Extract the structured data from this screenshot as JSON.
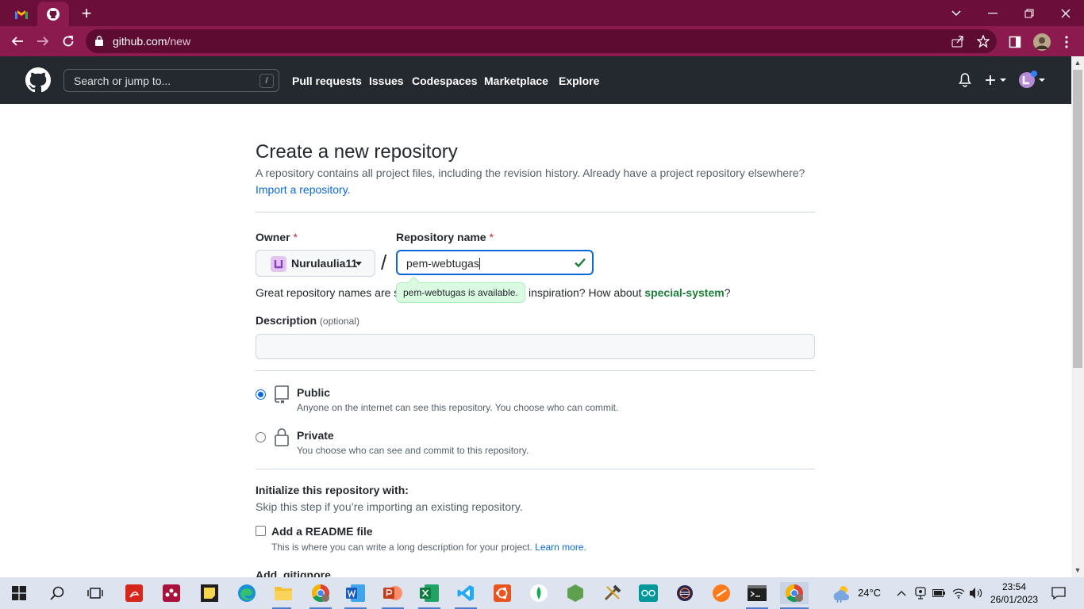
{
  "browser": {
    "url_host": "github.com",
    "url_path": "/new"
  },
  "github_header": {
    "search_placeholder": "Search or jump to...",
    "search_shortcut": "/",
    "nav": [
      "Pull requests",
      "Issues",
      "Codespaces",
      "Marketplace",
      "Explore"
    ]
  },
  "page": {
    "title": "Create a new repository",
    "subtitle": "A repository contains all project files, including the revision history. Already have a project repository elsewhere?",
    "import_link": "Import a repository.",
    "owner_label": "Owner",
    "required_mark": "*",
    "owner_name": "Nurulaulia11",
    "separator": "/",
    "repo_name_label": "Repository name",
    "repo_name_value": "pem-webtugas",
    "availability_tooltip": "pem-webtugas is available.",
    "great_prefix": "Great repository names are s",
    "great_middle": "d inspiration? How about ",
    "suggestion": "special-system",
    "great_suffix": "?",
    "description_label": "Description",
    "description_optional": "(optional)",
    "visibility": [
      {
        "title": "Public",
        "desc": "Anyone on the internet can see this repository. You choose who can commit.",
        "selected": true
      },
      {
        "title": "Private",
        "desc": "You choose who can see and commit to this repository.",
        "selected": false
      }
    ],
    "init_title": "Initialize this repository with:",
    "init_sub": "Skip this step if you’re importing an existing repository.",
    "readme_label": "Add a README file",
    "readme_desc": "This is where you can write a long description for your project. ",
    "readme_link": "Learn more.",
    "gitignore_label": "Add .gitignore"
  },
  "taskbar": {
    "weather": "24°C",
    "time": "23:54",
    "date": "26/01/2023"
  },
  "colors": {
    "tabstrip": "#6b0f3a",
    "addressbar": "#8b1a4f",
    "github_header": "#24292f",
    "link": "#0969da",
    "success": "#1a7f37"
  }
}
